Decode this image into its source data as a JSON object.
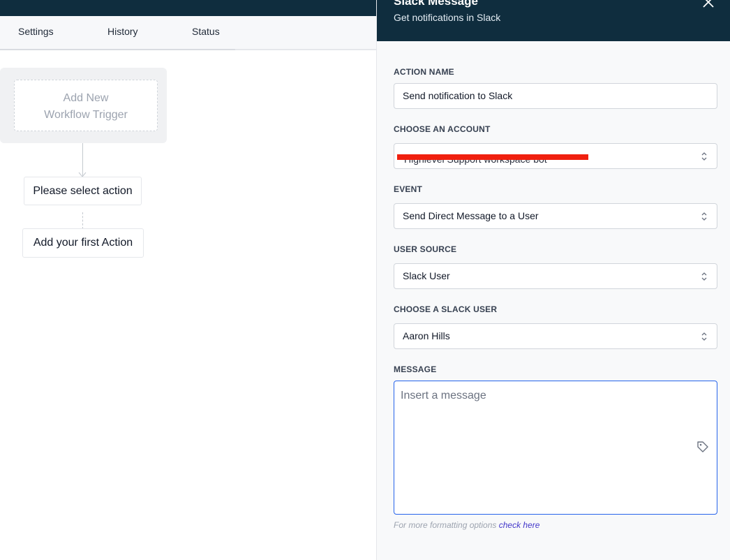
{
  "tabs": [
    {
      "label": "Settings"
    },
    {
      "label": "History"
    },
    {
      "label": "Status"
    }
  ],
  "workflow": {
    "trigger_line1": "Add New",
    "trigger_line2": "Workflow Trigger",
    "select_action": "Please select action",
    "first_action": "Add your first Action"
  },
  "panel": {
    "title": "Slack Message",
    "subtitle": "Get notifications in Slack",
    "close_icon": "close-icon"
  },
  "form": {
    "action_name": {
      "label": "ACTION NAME",
      "value": "Send notification to Slack"
    },
    "account": {
      "label": "CHOOSE AN ACCOUNT",
      "value": "Highlevel Support workspace bot"
    },
    "event": {
      "label": "EVENT",
      "value": "Send Direct Message to a User"
    },
    "user_source": {
      "label": "USER SOURCE",
      "value": "Slack User"
    },
    "slack_user": {
      "label": "CHOOSE A SLACK USER",
      "value": "Aaron Hills"
    },
    "message": {
      "label": "MESSAGE",
      "placeholder": "Insert a message",
      "icon": "tag-icon"
    },
    "help": {
      "text": "For more formatting options",
      "link": "check here"
    }
  },
  "colors": {
    "header_bg": "#0f2d3e",
    "focus_border": "#2563eb",
    "link": "#4338ca",
    "redaction": "#f0200f"
  }
}
